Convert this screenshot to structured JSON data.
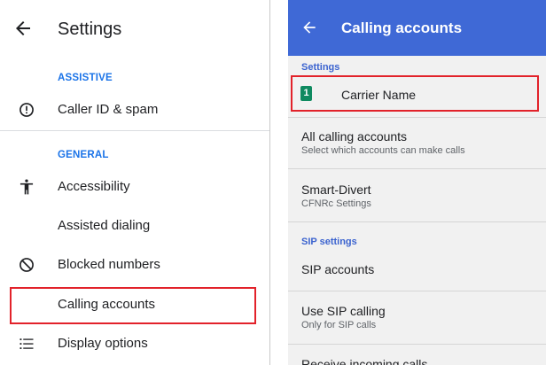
{
  "left": {
    "title": "Settings",
    "sections": [
      {
        "header": "ASSISTIVE",
        "items": [
          {
            "label": "Caller ID & spam",
            "icon": "info-circle-icon"
          }
        ]
      },
      {
        "header": "GENERAL",
        "items": [
          {
            "label": "Accessibility",
            "icon": "accessibility-icon"
          },
          {
            "label": "Assisted dialing",
            "icon": ""
          },
          {
            "label": "Blocked numbers",
            "icon": "block-icon"
          },
          {
            "label": "Calling accounts",
            "icon": "",
            "highlighted": true
          },
          {
            "label": "Display options",
            "icon": "list-icon"
          }
        ]
      }
    ]
  },
  "right": {
    "title": "Calling accounts",
    "accent_color": "#3f69d6",
    "sections": [
      {
        "header": "Settings",
        "items": [
          {
            "sim_badge": "1",
            "title": "Carrier Name",
            "highlighted": true
          },
          {
            "title": "All calling accounts",
            "subtitle": "Select which accounts can make calls"
          },
          {
            "title": "Smart-Divert",
            "subtitle": "CFNRc Settings"
          }
        ]
      },
      {
        "header": "SIP settings",
        "items": [
          {
            "title": "SIP accounts"
          },
          {
            "title": "Use SIP calling",
            "subtitle": "Only for SIP calls"
          },
          {
            "title": "Receive incoming calls"
          }
        ]
      }
    ]
  },
  "highlight_color": "#e2222a"
}
